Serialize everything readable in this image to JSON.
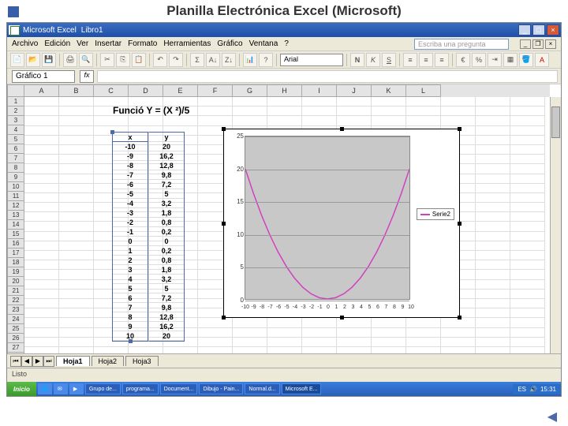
{
  "slide_title": "Planilla Electrónica Excel (Microsoft)",
  "titlebar": {
    "app": "Microsoft Excel",
    "doc": "Libro1"
  },
  "menubar": {
    "items": [
      "Archivo",
      "Edición",
      "Ver",
      "Insertar",
      "Formato",
      "Herramientas",
      "Gráfico",
      "Ventana",
      "?"
    ],
    "question": "Escriba una pregunta"
  },
  "namebox": "Gráfico 1",
  "fontname": "Arial",
  "formula_title": "Funció Y = (X ²)/5",
  "table": {
    "hx": "x",
    "hy": "y",
    "rows": [
      {
        "x": "-10",
        "y": "20"
      },
      {
        "x": "-9",
        "y": "16,2"
      },
      {
        "x": "-8",
        "y": "12,8"
      },
      {
        "x": "-7",
        "y": "9,8"
      },
      {
        "x": "-6",
        "y": "7,2"
      },
      {
        "x": "-5",
        "y": "5"
      },
      {
        "x": "-4",
        "y": "3,2"
      },
      {
        "x": "-3",
        "y": "1,8"
      },
      {
        "x": "-2",
        "y": "0,8"
      },
      {
        "x": "-1",
        "y": "0,2"
      },
      {
        "x": "0",
        "y": "0"
      },
      {
        "x": "1",
        "y": "0,2"
      },
      {
        "x": "2",
        "y": "0,8"
      },
      {
        "x": "3",
        "y": "1,8"
      },
      {
        "x": "4",
        "y": "3,2"
      },
      {
        "x": "5",
        "y": "5"
      },
      {
        "x": "6",
        "y": "7,2"
      },
      {
        "x": "7",
        "y": "9,8"
      },
      {
        "x": "8",
        "y": "12,8"
      },
      {
        "x": "9",
        "y": "16,2"
      },
      {
        "x": "10",
        "y": "20"
      }
    ]
  },
  "chart_data": {
    "type": "line",
    "title": "",
    "series_name": "Serie2",
    "x": [
      -10,
      -9,
      -8,
      -7,
      -6,
      -5,
      -4,
      -3,
      -2,
      -1,
      0,
      1,
      2,
      3,
      4,
      5,
      6,
      7,
      8,
      9,
      10
    ],
    "y": [
      20,
      16.2,
      12.8,
      9.8,
      7.2,
      5,
      3.2,
      1.8,
      0.8,
      0.2,
      0,
      0.2,
      0.8,
      1.8,
      3.2,
      5,
      7.2,
      9.8,
      12.8,
      16.2,
      20
    ],
    "ylim": [
      0,
      25
    ],
    "yticks": [
      0,
      5,
      10,
      15,
      20,
      25
    ],
    "xticks": [
      -10,
      -9,
      -8,
      -7,
      -6,
      -5,
      -4,
      -3,
      -2,
      -1,
      0,
      1,
      2,
      3,
      4,
      5,
      6,
      7,
      8,
      9,
      10
    ],
    "xlabel": "",
    "ylabel": ""
  },
  "columns": [
    "A",
    "B",
    "C",
    "D",
    "E",
    "F",
    "G",
    "H",
    "I",
    "J",
    "K",
    "L"
  ],
  "rowcount": 28,
  "sheet_tabs": {
    "active": "Hoja1",
    "tabs": [
      "Hoja1",
      "Hoja2",
      "Hoja3"
    ]
  },
  "status": "Listo",
  "taskbar": {
    "start": "Inicio",
    "items": [
      "Grupo de...",
      "programa...",
      "Document...",
      "Dibujo - Pain...",
      "Normal.d...",
      "Microsoft E..."
    ],
    "active_index": 5,
    "lang": "ES",
    "time": "15:31"
  }
}
